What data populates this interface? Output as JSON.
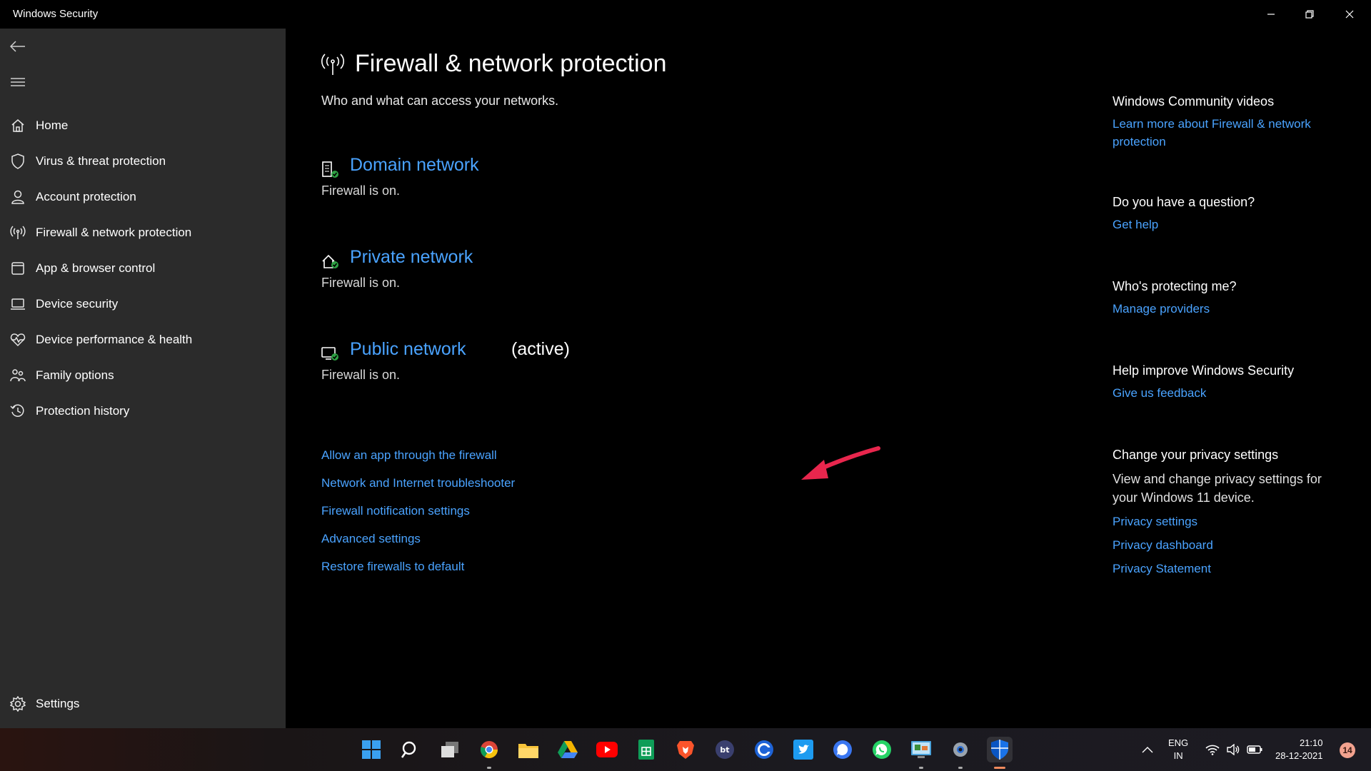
{
  "window": {
    "title": "Windows Security",
    "controls": [
      "minimize-icon",
      "restore-icon",
      "close-icon"
    ]
  },
  "sidebar": {
    "back_icon": "back-arrow-icon",
    "menu_icon": "hamburger-menu-icon",
    "items": [
      {
        "label": "Home",
        "icon": "home-icon"
      },
      {
        "label": "Virus & threat protection",
        "icon": "shield-icon"
      },
      {
        "label": "Account protection",
        "icon": "person-icon"
      },
      {
        "label": "Firewall & network protection",
        "icon": "antenna-icon"
      },
      {
        "label": "App & browser control",
        "icon": "browser-window-icon"
      },
      {
        "label": "Device security",
        "icon": "laptop-icon"
      },
      {
        "label": "Device performance & health",
        "icon": "heart-pulse-icon"
      },
      {
        "label": "Family options",
        "icon": "family-icon"
      },
      {
        "label": "Protection history",
        "icon": "history-icon"
      }
    ],
    "settings_label": "Settings"
  },
  "main": {
    "title": "Firewall & network protection",
    "subtitle": "Who and what can access your networks.",
    "networks": [
      {
        "name": "Domain network",
        "status": "Firewall is on.",
        "active_label": "",
        "icon": "domain-network-icon"
      },
      {
        "name": "Private network",
        "status": "Firewall is on.",
        "active_label": "",
        "icon": "private-network-icon"
      },
      {
        "name": "Public network",
        "status": "Firewall is on.",
        "active_label": "(active)",
        "icon": "public-network-icon"
      }
    ],
    "links": [
      "Allow an app through the firewall",
      "Network and Internet troubleshooter",
      "Firewall notification settings",
      "Advanced settings",
      "Restore firewalls to default"
    ]
  },
  "right": {
    "community": {
      "heading": "Windows Community videos",
      "link": "Learn more about Firewall & network protection"
    },
    "question": {
      "heading": "Do you have a question?",
      "link": "Get help"
    },
    "protecting": {
      "heading": "Who's protecting me?",
      "link": "Manage providers"
    },
    "improve": {
      "heading": "Help improve Windows Security",
      "link": "Give us feedback"
    },
    "privacy": {
      "heading": "Change your privacy settings",
      "text": "View and change privacy settings for your Windows 11 device.",
      "links": [
        "Privacy settings",
        "Privacy dashboard",
        "Privacy Statement"
      ]
    }
  },
  "taskbar": {
    "apps": [
      "start-icon",
      "search-icon",
      "task-view-icon",
      "chrome-icon",
      "file-explorer-icon",
      "google-drive-icon",
      "youtube-icon",
      "google-sheets-icon",
      "brave-icon",
      "bt-app-icon",
      "ccleaner-icon",
      "twitter-icon",
      "signal-icon",
      "whatsapp-icon",
      "control-panel-icon",
      "settings-gear-icon",
      "windows-security-icon"
    ],
    "language": {
      "line1": "ENG",
      "line2": "IN"
    },
    "clock": {
      "time": "21:10",
      "date": "28-12-2021"
    },
    "notification_count": "14"
  },
  "colors": {
    "link": "#4aa3ff",
    "sidebar_bg": "#2b2b2b",
    "background": "#000000",
    "annotation_arrow": "#e8264d"
  }
}
